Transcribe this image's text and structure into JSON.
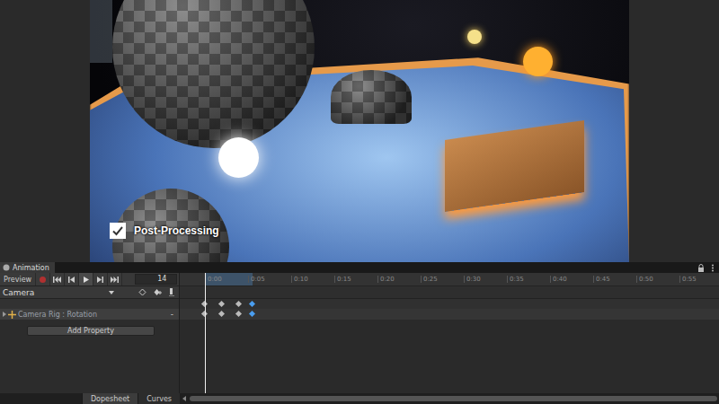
{
  "scene": {
    "overlay": {
      "label": "Post-Processing",
      "checked": true
    }
  },
  "animation": {
    "title": "Animation",
    "preview": {
      "label": "Preview",
      "selected": false
    },
    "recording": false,
    "playing": true,
    "frame": "14",
    "clip": "Camera",
    "ruler": [
      "0:00",
      "0:05",
      "0:10",
      "0:15",
      "0:20",
      "0:25",
      "0:30",
      "0:35",
      "0:40",
      "0:45",
      "0:50",
      "0:55"
    ],
    "tracks": [
      {
        "label": "Camera Rig : Rotation",
        "selected": true,
        "remove": "-"
      }
    ],
    "keyframes": [
      {
        "frame": 0,
        "selected": false
      },
      {
        "frame": 2,
        "selected": false
      },
      {
        "frame": 4,
        "selected": false
      },
      {
        "frame": 5.5,
        "selected": true
      }
    ],
    "add_property": "Add Property",
    "views": [
      {
        "label": "Dopesheet",
        "selected": true
      },
      {
        "label": "Curves",
        "selected": false
      }
    ]
  }
}
